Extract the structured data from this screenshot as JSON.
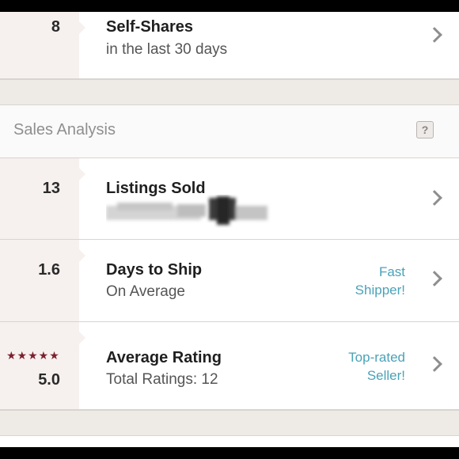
{
  "self_shares": {
    "value": "8",
    "title": "Self-Shares",
    "subtitle": "in the last 30 days"
  },
  "section": {
    "title": "Sales Analysis",
    "help_label": "?"
  },
  "listings_sold": {
    "value": "13",
    "title": "Listings Sold"
  },
  "days_to_ship": {
    "value": "1.6",
    "title": "Days to Ship",
    "subtitle": "On Average",
    "badge_line1": "Fast",
    "badge_line2": "Shipper!"
  },
  "average_rating": {
    "value": "5.0",
    "stars": "★★★★★",
    "rating": 5,
    "title": "Average Rating",
    "subtitle": "Total Ratings: 12",
    "badge_line1": "Top-rated",
    "badge_line2": "Seller!"
  },
  "colors": {
    "accent": "#4aa2b8",
    "star": "#7d1f2e",
    "left_column": "#f6f1ee",
    "band": "#eeebe6"
  }
}
